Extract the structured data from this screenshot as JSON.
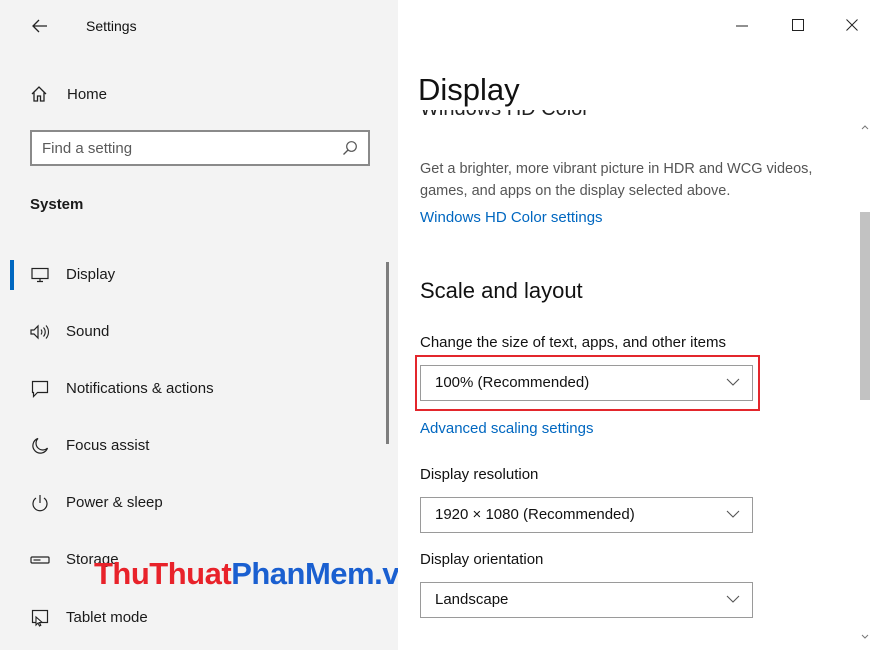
{
  "window": {
    "title": "Settings",
    "controls": {
      "minimize": "minimize-icon",
      "maximize": "maximize-icon",
      "close": "close-icon"
    }
  },
  "sidebar": {
    "home_label": "Home",
    "search_placeholder": "Find a setting",
    "section_title": "System",
    "items": [
      {
        "label": "Display",
        "icon": "monitor-icon",
        "active": true
      },
      {
        "label": "Sound",
        "icon": "speaker-icon"
      },
      {
        "label": "Notifications & actions",
        "icon": "notification-icon"
      },
      {
        "label": "Focus assist",
        "icon": "moon-icon"
      },
      {
        "label": "Power & sleep",
        "icon": "power-icon"
      },
      {
        "label": "Storage",
        "icon": "storage-icon"
      },
      {
        "label": "Tablet mode",
        "icon": "tablet-mode-icon"
      }
    ]
  },
  "watermark": {
    "part1": "ThuThuat",
    "part2": "PhanMem",
    "part3": ".vn"
  },
  "main": {
    "title": "Display",
    "cut_heading": "Windows HD Color",
    "hdr_description": "Get a brighter, more vibrant picture in HDR and WCG videos, games, and apps on the display selected above.",
    "hdr_link": "Windows HD Color settings",
    "scale_heading": "Scale and layout",
    "scale_label": "Change the size of text, apps, and other items",
    "scale_value": "100% (Recommended)",
    "advanced_link": "Advanced scaling settings",
    "resolution_label": "Display resolution",
    "resolution_value": "1920 × 1080 (Recommended)",
    "orientation_label": "Display orientation",
    "orientation_value": "Landscape"
  },
  "colors": {
    "accent": "#0067c0",
    "highlight_border": "#e3262c",
    "watermark_blue": "#1a5fd0",
    "watermark_red": "#e8222a"
  }
}
